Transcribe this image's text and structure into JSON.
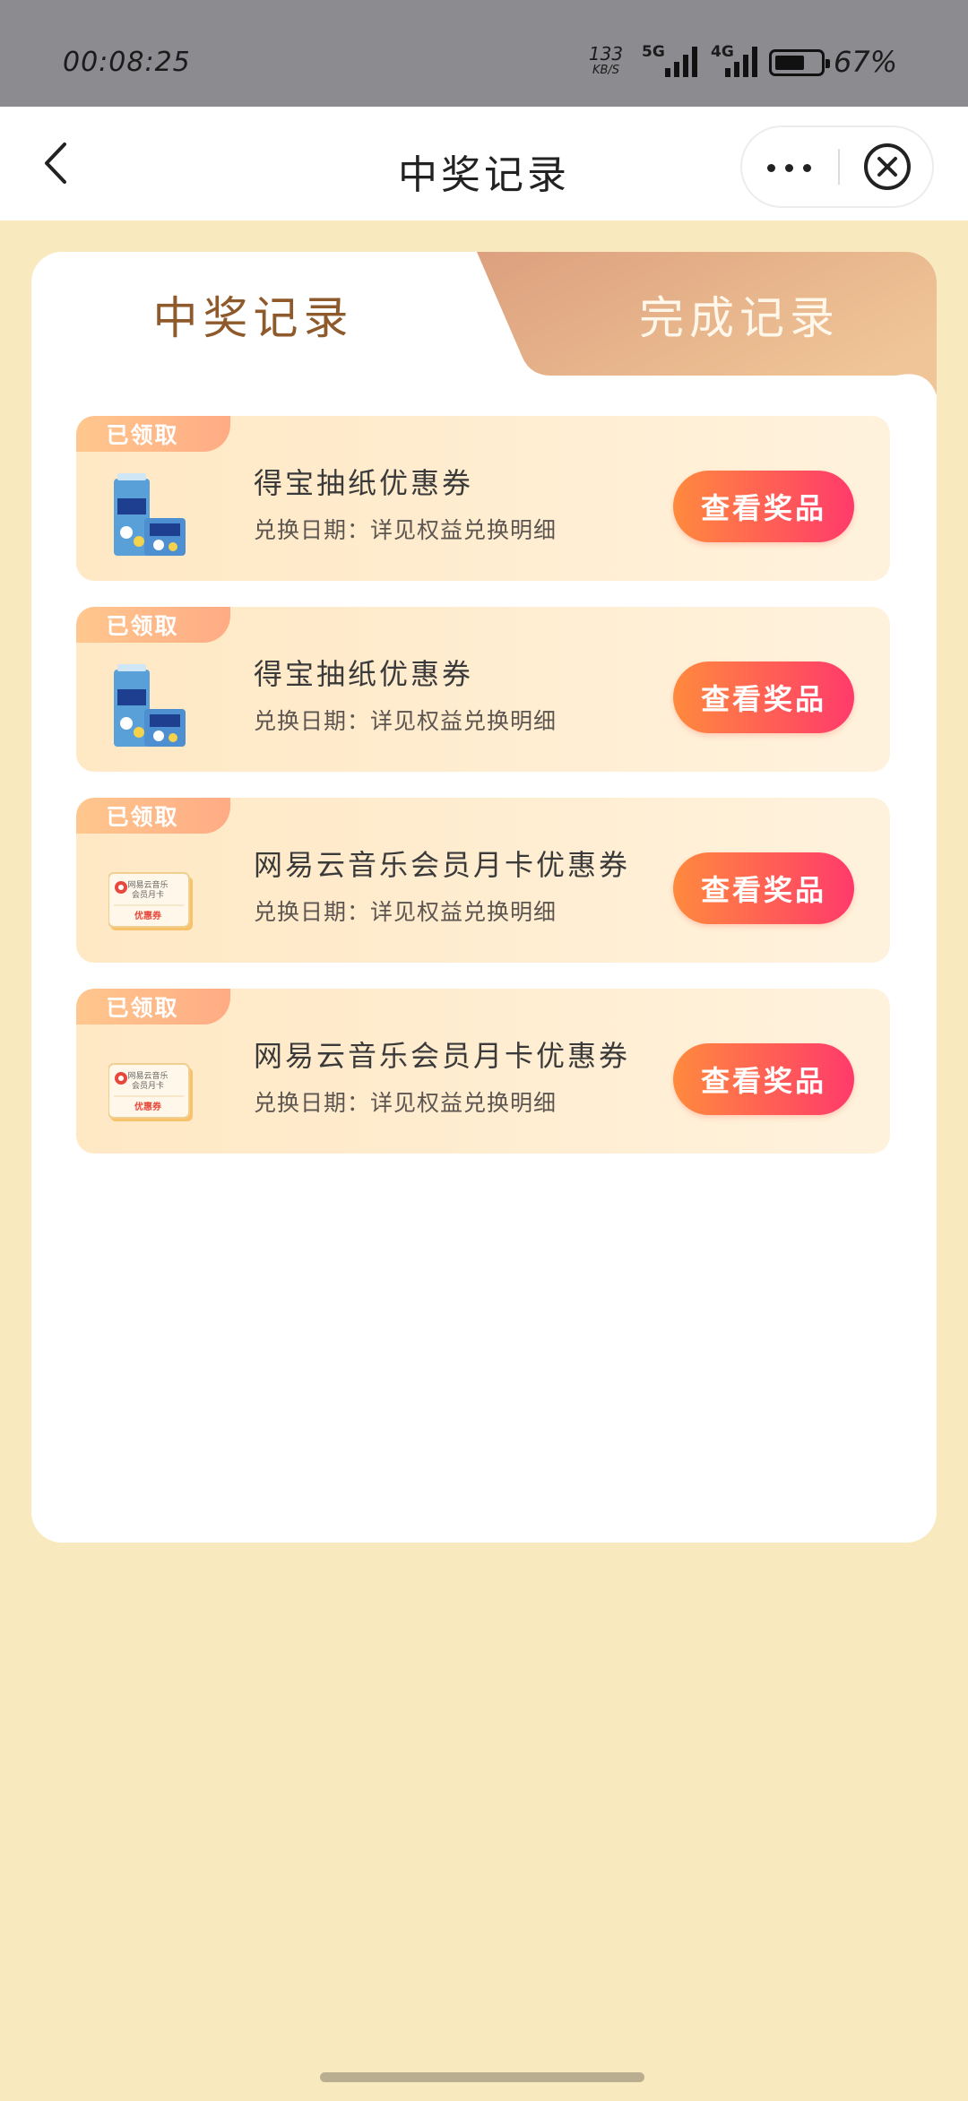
{
  "status_bar": {
    "time": "00:08:25",
    "speed_value": "133",
    "speed_unit": "KB/S",
    "network_1": "5G",
    "network_2": "4G",
    "battery_level": 0.67,
    "battery_text": "67%"
  },
  "nav": {
    "title": "中奖记录"
  },
  "tabs": [
    {
      "label": "中奖记录",
      "active": true
    },
    {
      "label": "完成记录",
      "active": false
    }
  ],
  "records": [
    {
      "badge": "已领取",
      "title": "得宝抽纸优惠券",
      "subtitle": "兑换日期：详见权益兑换明细",
      "button": "查看奖品",
      "thumb": "tissue-pack-image"
    },
    {
      "badge": "已领取",
      "title": "得宝抽纸优惠券",
      "subtitle": "兑换日期：详见权益兑换明细",
      "button": "查看奖品",
      "thumb": "tissue-pack-image"
    },
    {
      "badge": "已领取",
      "title": "网易云音乐会员月卡优惠券",
      "subtitle": "兑换日期：详见权益兑换明细",
      "button": "查看奖品",
      "thumb": "music-coupon-image",
      "coupon_line1": "网易云音乐",
      "coupon_line2": "会员月卡",
      "coupon_label": "优惠券"
    },
    {
      "badge": "已领取",
      "title": "网易云音乐会员月卡优惠券",
      "subtitle": "兑换日期：详见权益兑换明细",
      "button": "查看奖品",
      "thumb": "music-coupon-image",
      "coupon_line1": "网易云音乐",
      "coupon_line2": "会员月卡",
      "coupon_label": "优惠券"
    }
  ],
  "colors": {
    "page_bg": "#f8e9bf",
    "active_tab_text": "#8e5a2c",
    "button_gradient_start": "#ff8a3d",
    "button_gradient_end": "#ff3a6b",
    "badge_bg": "#ffb789"
  }
}
